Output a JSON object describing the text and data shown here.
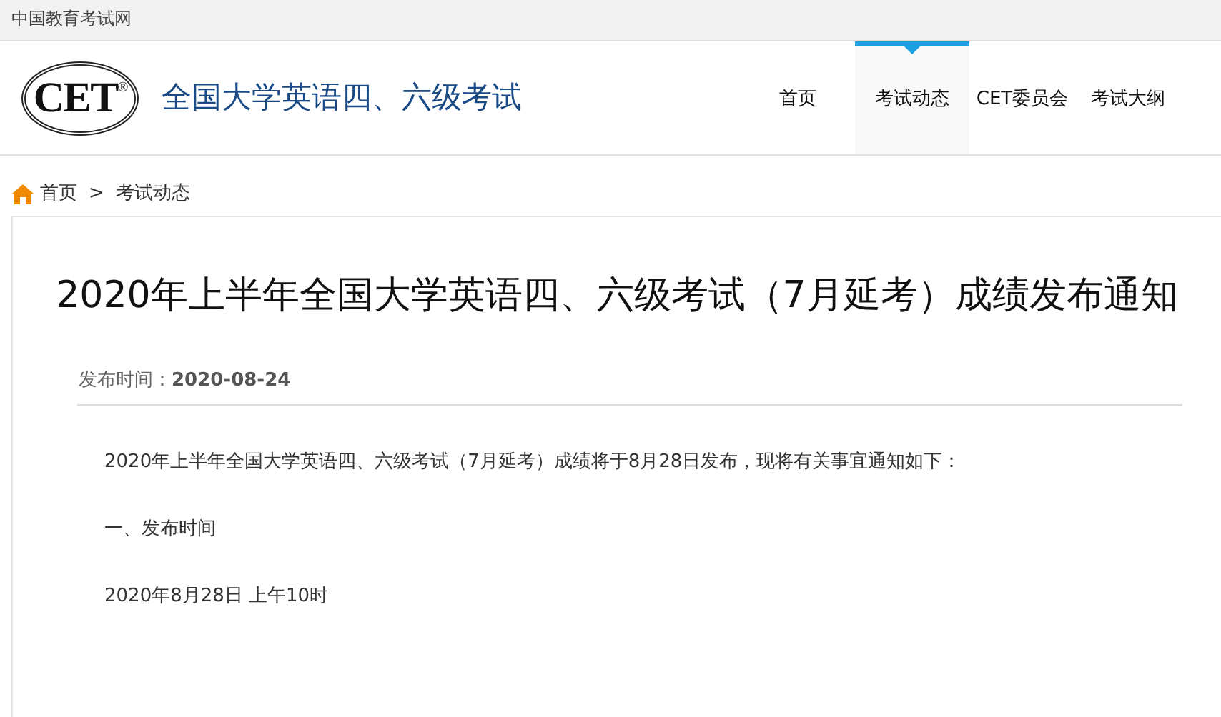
{
  "top_bar": {
    "site_name": "中国教育考试网"
  },
  "header": {
    "logo_text": "CET",
    "logo_mark": "®",
    "title": "全国大学英语四、六级考试"
  },
  "nav": [
    {
      "label": "首页",
      "selected": false
    },
    {
      "label": "考试动态",
      "selected": true
    },
    {
      "label": "CET委员会",
      "selected": false
    },
    {
      "label": "考试大纲",
      "selected": false
    }
  ],
  "breadcrumb": [
    "首页",
    "考试动态"
  ],
  "breadcrumb_separator": ">",
  "article": {
    "title": "2020年上半年全国大学英语四、六级考试（7月延考）成绩发布通知",
    "date_label": "发布时间：",
    "date": "2020-08-24",
    "paragraphs": [
      "2020年上半年全国大学英语四、六级考试（7月延考）成绩将于8月28日发布，现将有关事宜通知如下：",
      "一、发布时间",
      "2020年8月28日 上午10时"
    ]
  }
}
